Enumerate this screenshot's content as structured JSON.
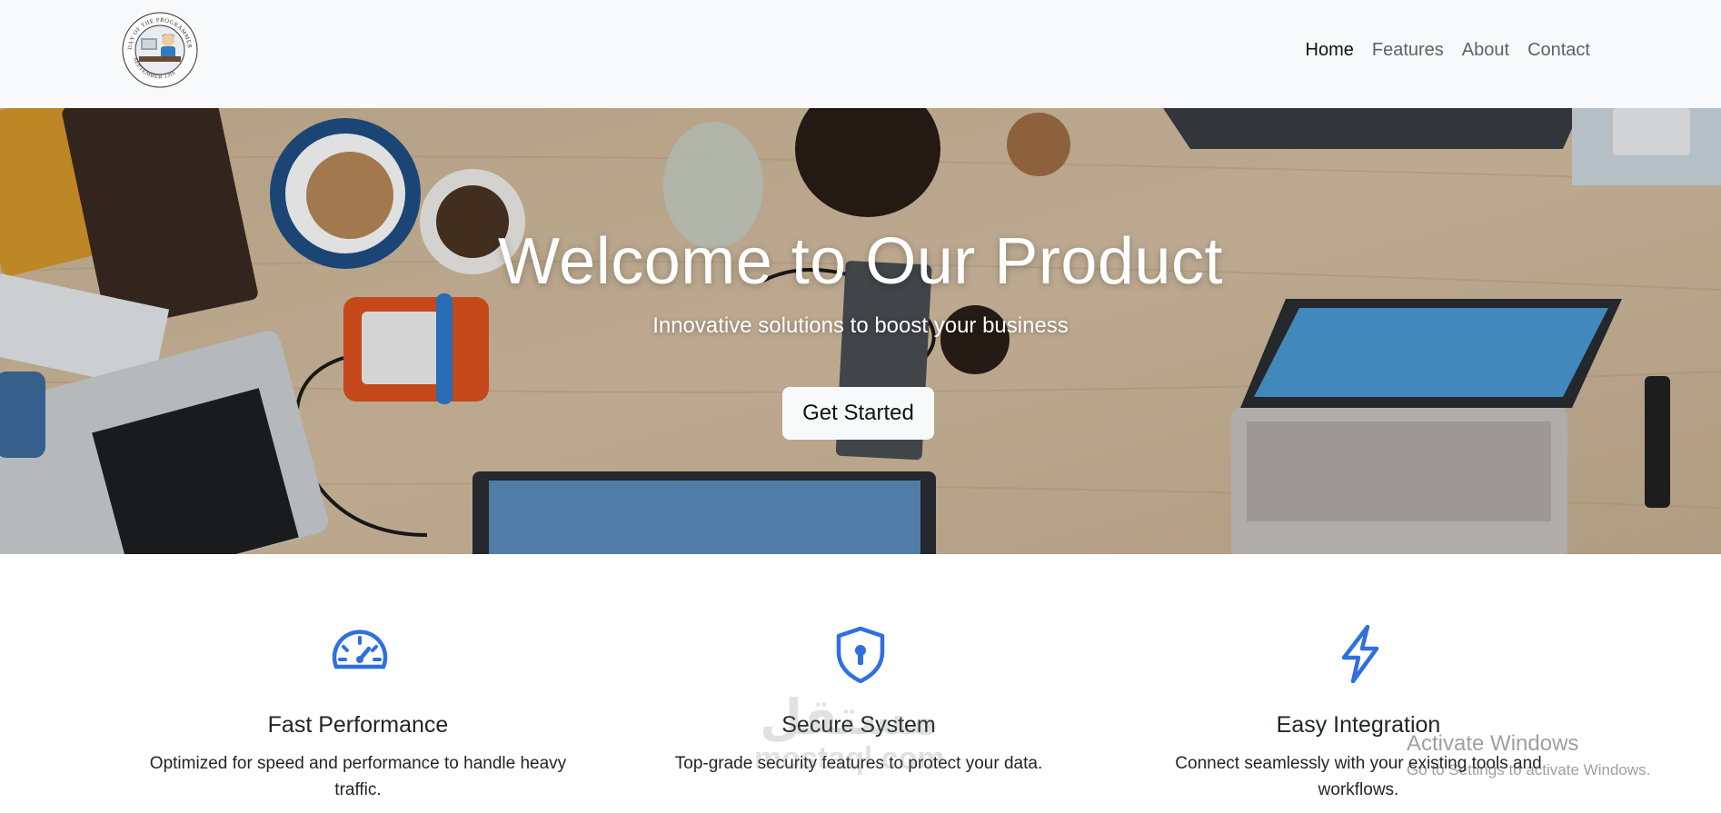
{
  "navbar": {
    "logo": {
      "text_top": "DAY OF THE PROGRAMMER",
      "text_bottom": "SEPTEMBER 13th",
      "icon": "programmer-avatar-logo"
    },
    "links": [
      {
        "label": "Home",
        "active": true
      },
      {
        "label": "Features",
        "active": false
      },
      {
        "label": "About",
        "active": false
      },
      {
        "label": "Contact",
        "active": false
      }
    ]
  },
  "hero": {
    "title": "Welcome to Our Product",
    "subtitle": "Innovative solutions to boost your business",
    "cta_label": "Get Started",
    "background": "desk-with-laptops-photo"
  },
  "features": [
    {
      "icon": "speedometer-icon",
      "title": "Fast Performance",
      "text": "Optimized for speed and performance to handle heavy traffic."
    },
    {
      "icon": "shield-lock-icon",
      "title": "Secure System",
      "text": "Top-grade security features to protect your data."
    },
    {
      "icon": "lightning-icon",
      "title": "Easy Integration",
      "text": "Connect seamlessly with your existing tools and workflows."
    }
  ],
  "watermarks": {
    "mostaql_ar": "مستقل",
    "mostaql_en": "mostaql.com",
    "activate_title": "Activate Windows",
    "activate_sub": "Go to Settings to activate Windows."
  },
  "colors": {
    "accent": "#2f6fe0",
    "navbar_bg": "#f8f9fa",
    "button_bg": "#f8f9fa"
  }
}
